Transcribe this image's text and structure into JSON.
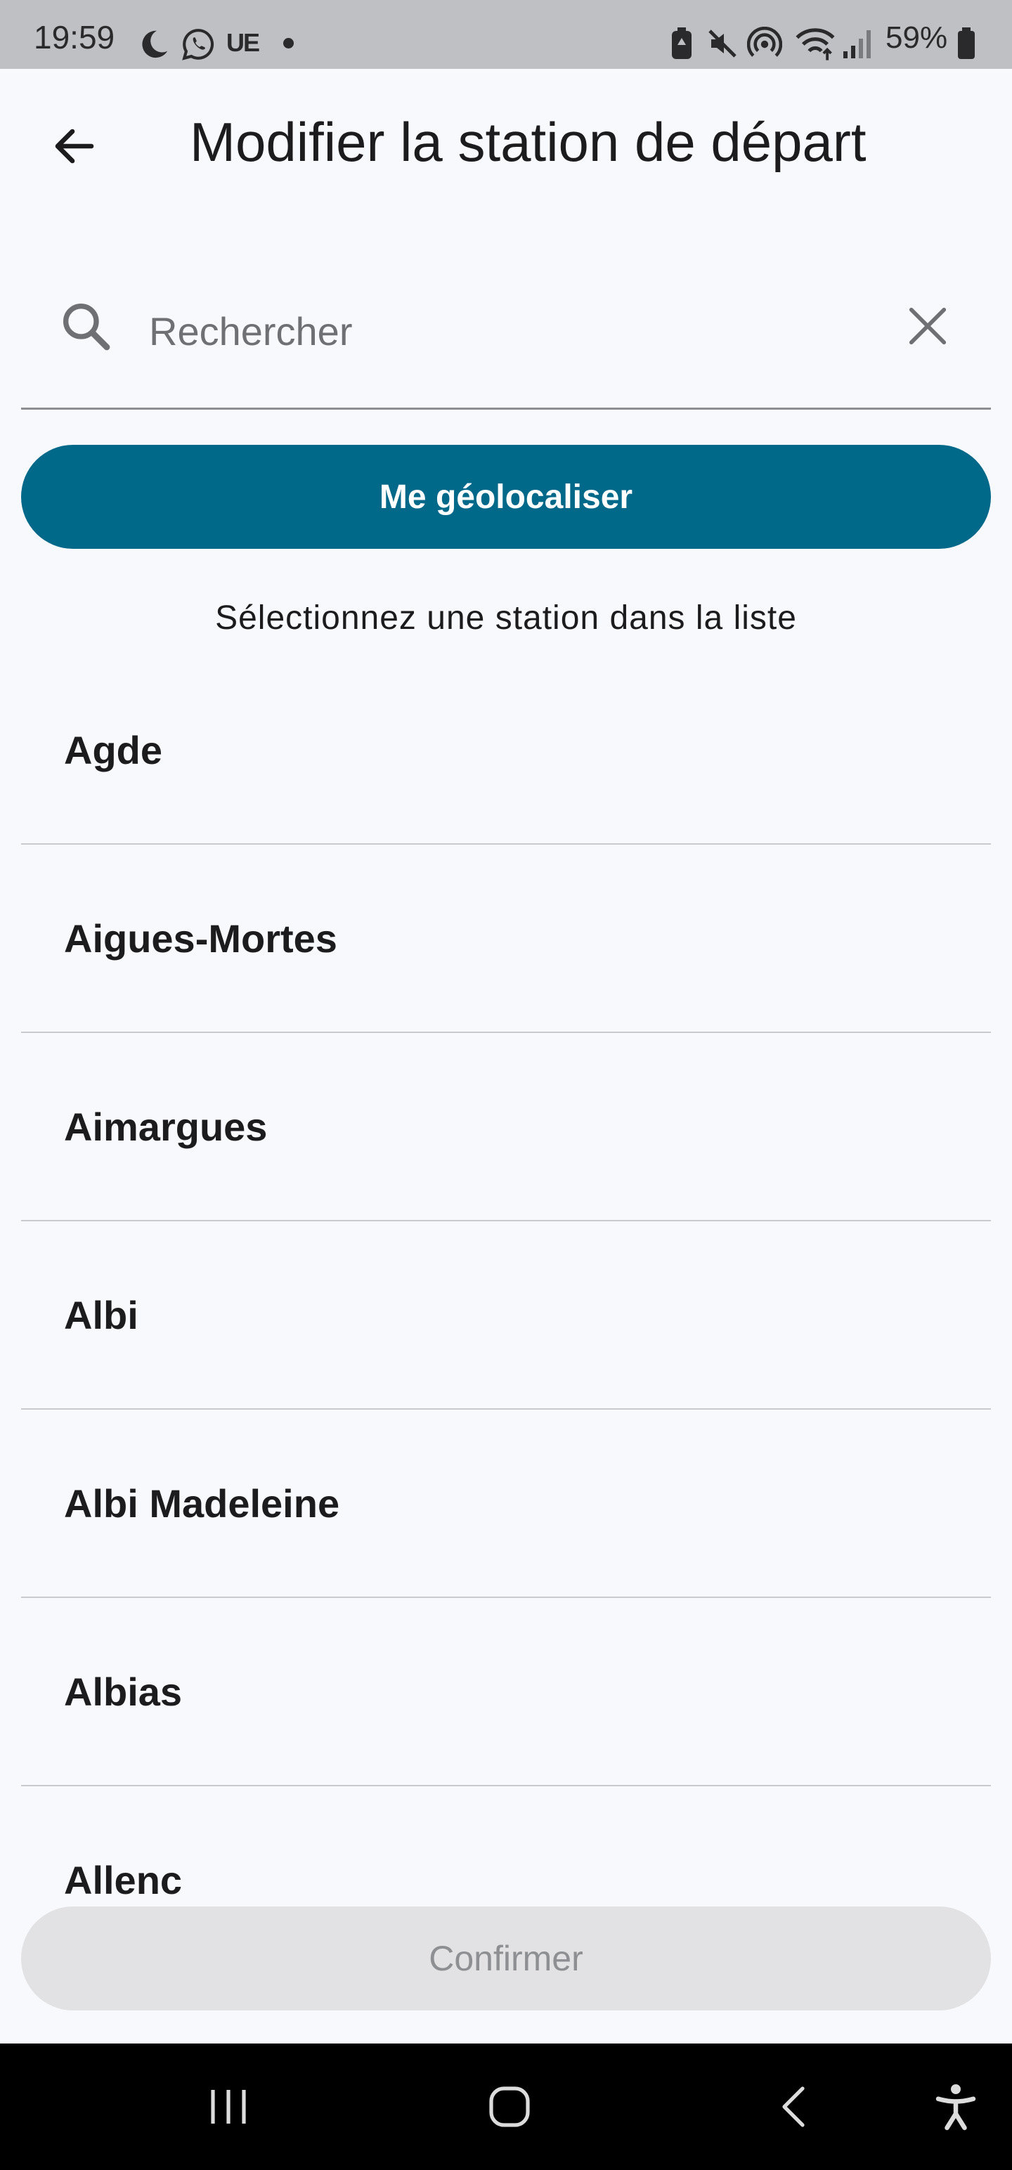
{
  "status_bar": {
    "time": "19:59",
    "carrier_tag": "UE",
    "battery_percent": "59%",
    "icons": [
      "moon-icon",
      "whatsapp-icon",
      "dot-icon",
      "battery-saver-icon",
      "mute-icon",
      "hotspot-icon",
      "wifi-icon",
      "signal-icon",
      "battery-icon"
    ]
  },
  "header": {
    "back_icon": "arrow-left-icon",
    "title": "Modifier la station de départ"
  },
  "search": {
    "value": "",
    "placeholder": "Rechercher",
    "search_icon": "search-icon",
    "clear_icon": "close-icon"
  },
  "geolocate_button": {
    "label": "Me géolocaliser"
  },
  "hint": "Sélectionnez une station dans la liste",
  "stations": [
    {
      "name": "Agde"
    },
    {
      "name": "Aigues-Mortes"
    },
    {
      "name": "Aimargues"
    },
    {
      "name": "Albi"
    },
    {
      "name": "Albi Madeleine"
    },
    {
      "name": "Albias"
    },
    {
      "name": "Allenc"
    }
  ],
  "confirm_button": {
    "label": "Confirmer"
  },
  "colors": {
    "accent": "#006888",
    "background": "#f8f9fc",
    "disabled_button": "#e2e2e4",
    "disabled_text": "#8e8f92",
    "status_bar": "#bfc0c3"
  },
  "nav_bar": {
    "icons": [
      "recent-apps-icon",
      "home-icon",
      "back-icon",
      "accessibility-icon"
    ]
  }
}
